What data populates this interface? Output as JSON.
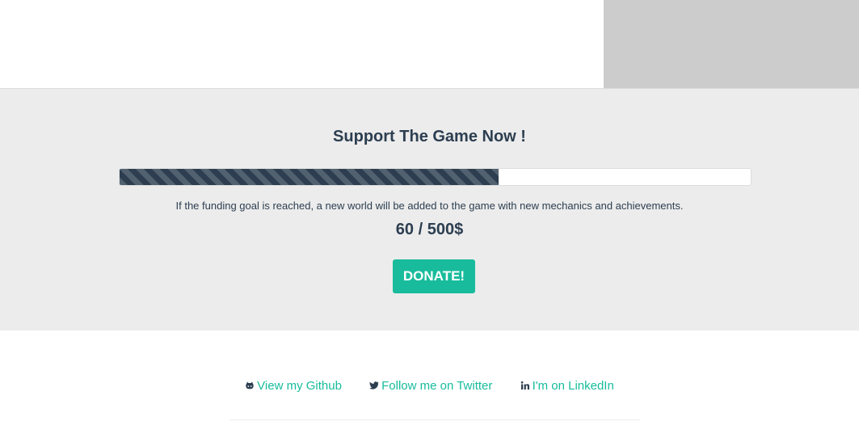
{
  "support": {
    "title": "Support The Game Now !",
    "description": "If the funding goal is reached, a new world will be added to the game with new mechanics and achievements.",
    "amount_text": "60 / 500$",
    "raised": 60,
    "goal": 500,
    "progress_fraction": 0.6,
    "donate_label": "DONATE!"
  },
  "links": [
    {
      "icon": "github-icon",
      "label": "View my Github"
    },
    {
      "icon": "twitter-icon",
      "label": "Follow me on Twitter"
    },
    {
      "icon": "linkedin-icon",
      "label": "I'm on LinkedIn"
    }
  ],
  "colors": {
    "accent": "#18bc9c",
    "primary": "#2c3e50",
    "section_bg": "#ececec",
    "image_placeholder": "#cccccc"
  }
}
